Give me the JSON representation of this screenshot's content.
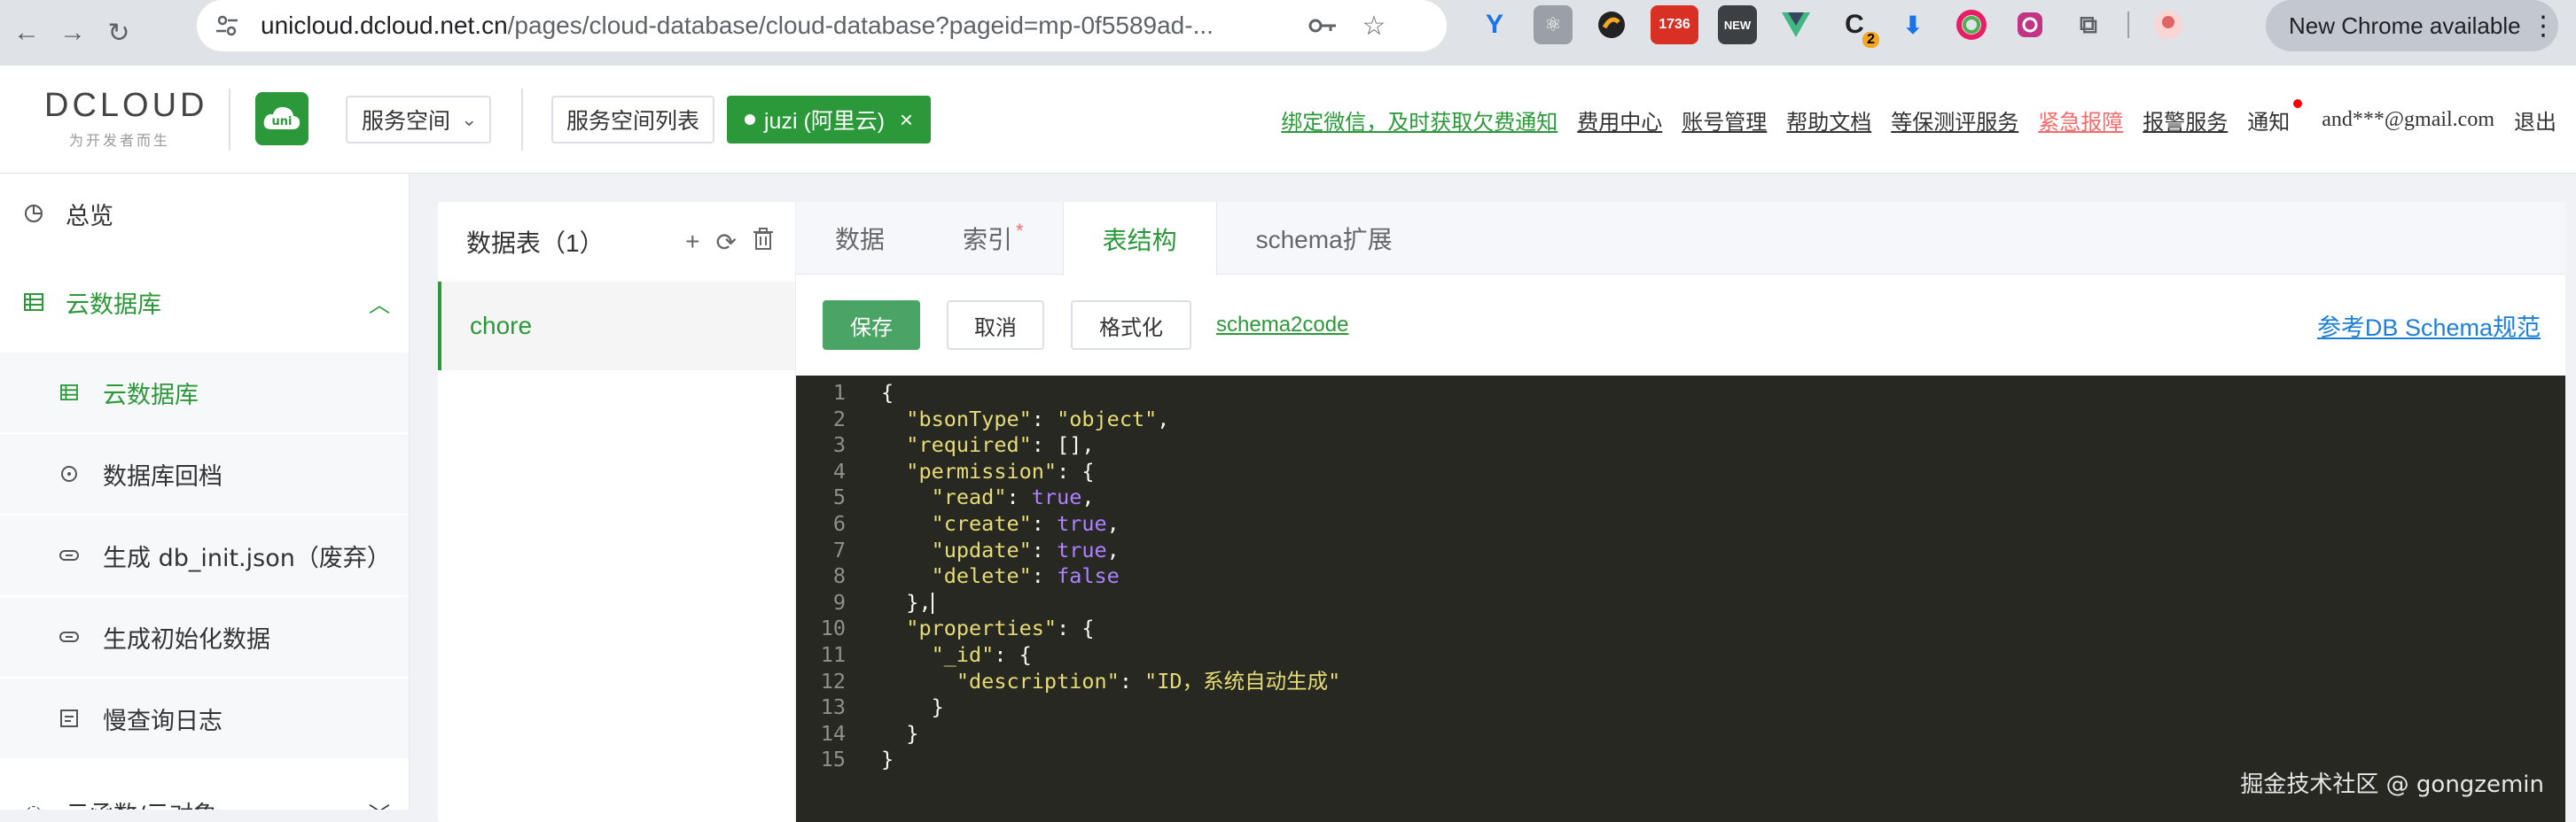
{
  "browser": {
    "url_host": "unicloud.dcloud.net.cn",
    "url_path": "/pages/cloud-database/cloud-database?pageid=mp-0f5589ad-...",
    "ext_badge_1736": "1736",
    "ext_badge_new": "NEW",
    "ext_badge_count": "2",
    "update_label": "New Chrome available"
  },
  "header": {
    "logo_text": "DCLOUD",
    "logo_sub": "为开发者而生",
    "uni_logo_text": "uni",
    "space_select": "服务空间",
    "space_list_btn": "服务空间列表",
    "current_space": "juzi (阿里云)",
    "links": {
      "wechat": "绑定微信，及时获取欠费通知",
      "billing": "费用中心",
      "account": "账号管理",
      "docs": "帮助文档",
      "security": "等保测评服务",
      "emergency": "紧急报障",
      "alert": "报警服务",
      "notify": "通知",
      "email": "and***@gmail.com",
      "logout": "退出"
    }
  },
  "sidebar": {
    "overview": "总览",
    "cloud_db": "云数据库",
    "sub_cloud_db": "云数据库",
    "db_rollback": "数据库回档",
    "gen_db_init": "生成 db_init.json（废弃）",
    "gen_init_data": "生成初始化数据",
    "slow_query": "慢查询日志",
    "cloud_func": "云函数/云对象"
  },
  "table_list": {
    "title": "数据表（1）",
    "items": [
      "chore"
    ]
  },
  "tabs": {
    "data": "数据",
    "index": "索引",
    "index_star": "*",
    "schema": "表结构",
    "schema_ext": "schema扩展"
  },
  "toolbar": {
    "save": "保存",
    "cancel": "取消",
    "format": "格式化",
    "schema2code": "schema2code",
    "ref_link": "参考DB Schema规范"
  },
  "editor": {
    "lines": [
      "{",
      "  \"bsonType\": \"object\",",
      "  \"required\": [],",
      "  \"permission\": {",
      "    \"read\": true,",
      "    \"create\": true,",
      "    \"update\": true,",
      "    \"delete\": false",
      "  },",
      "  \"properties\": {",
      "    \"_id\": {",
      "      \"description\": \"ID，系统自动生成\"",
      "    }",
      "  }",
      "}"
    ]
  },
  "watermark": "掘金技术社区 @ gongzemin",
  "colors": {
    "brand_green": "#2b9939",
    "editor_bg": "#272822",
    "string": "#e6db74",
    "boolean": "#ae81ff",
    "link_blue": "#1e7fd6",
    "danger": "#f56c6c"
  }
}
